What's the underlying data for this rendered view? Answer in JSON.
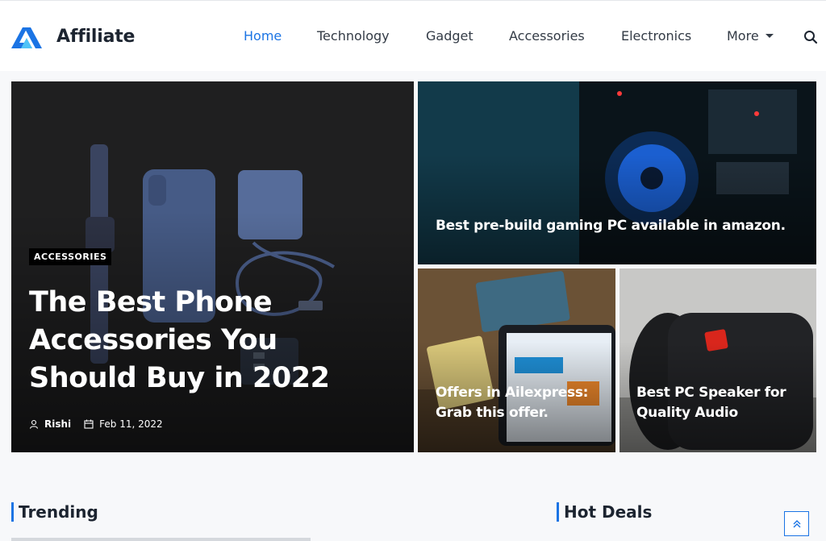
{
  "site": {
    "name": "Affiliate"
  },
  "nav": {
    "items": [
      {
        "label": "Home",
        "active": true
      },
      {
        "label": "Technology",
        "active": false
      },
      {
        "label": "Gadget",
        "active": false
      },
      {
        "label": "Accessories",
        "active": false
      },
      {
        "label": "Electronics",
        "active": false
      },
      {
        "label": "More",
        "active": false
      }
    ],
    "search_icon": "search-icon"
  },
  "featured": {
    "main": {
      "category": "ACCESSORIES",
      "title": "The Best Phone Accessories You Should Buy in 2022",
      "author": "Rishi",
      "date": "Feb 11, 2022"
    },
    "cards": [
      {
        "title": "Best pre-build gaming PC available in amazon."
      },
      {
        "title": "Offers in Ailexpress: Grab this offer."
      },
      {
        "title": "Best PC Speaker for Quality Audio"
      }
    ]
  },
  "sections": {
    "trending": "Trending",
    "hot_deals": "Hot Deals"
  },
  "colors": {
    "accent": "#1b74e4",
    "text": "#1c2430",
    "logo_dark": "#1b74e4",
    "logo_light": "#4fc3f7"
  }
}
